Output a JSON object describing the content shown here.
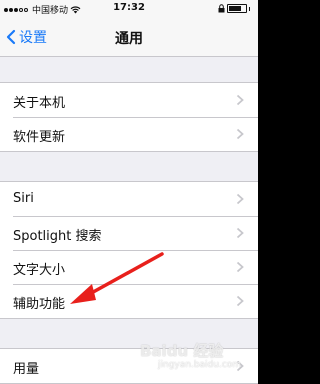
{
  "status_bar": {
    "carrier": "中国移动",
    "time": "17:32",
    "signal_bars_filled": 3,
    "signal_bars_total": 5,
    "battery_level": 0.75
  },
  "nav": {
    "back_label": "设置",
    "title": "通用"
  },
  "groups": [
    {
      "items": [
        {
          "label": "关于本机"
        },
        {
          "label": "软件更新"
        }
      ]
    },
    {
      "items": [
        {
          "label": "Siri"
        },
        {
          "label": "Spotlight 搜索"
        },
        {
          "label": "文字大小"
        },
        {
          "label": "辅助功能"
        }
      ]
    },
    {
      "items": [
        {
          "label": "用量"
        }
      ]
    }
  ],
  "watermark": {
    "text": "Baidu 经验",
    "sub": "jingyan.baidu.com"
  },
  "colors": {
    "accent": "#1a7af8",
    "annotation_arrow": "#e8201c",
    "background": "#efeff4"
  },
  "icons": [
    "wifi-icon",
    "back-chevron-icon",
    "chevron-right-icon",
    "battery-icon",
    "lock-icon"
  ]
}
